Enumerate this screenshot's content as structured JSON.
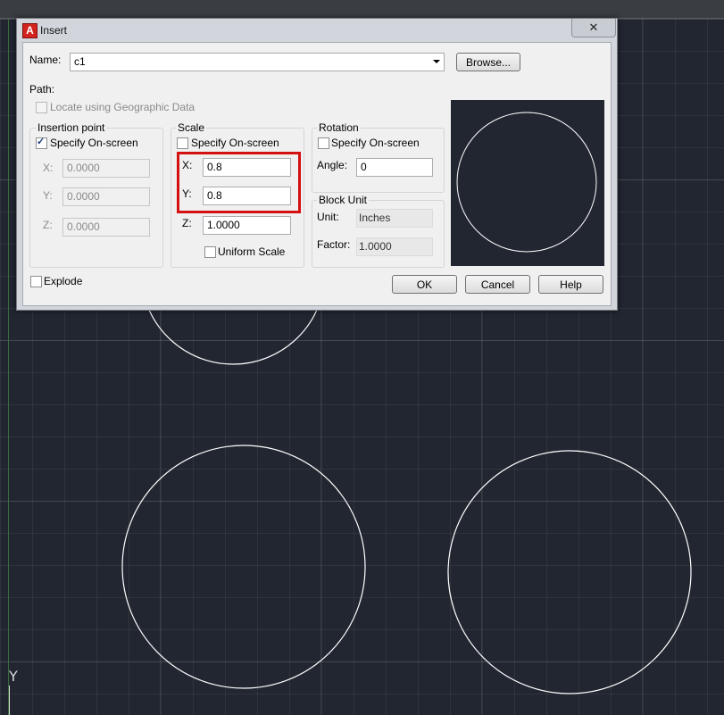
{
  "dialog": {
    "title": "Insert",
    "close_glyph": "✕",
    "name_label": "Name:",
    "name_value": "c1",
    "browse_label": "Browse...",
    "path_label": "Path:",
    "geo_label": "Locate using Geographic Data",
    "insertion_point": {
      "title": "Insertion point",
      "specify_label": "Specify On-screen",
      "specify_checked": true,
      "x_label": "X:",
      "x_value": "0.0000",
      "y_label": "Y:",
      "y_value": "0.0000",
      "z_label": "Z:",
      "z_value": "0.0000"
    },
    "scale": {
      "title": "Scale",
      "specify_label": "Specify On-screen",
      "specify_checked": false,
      "x_label": "X:",
      "x_value": "0.8",
      "y_label": "Y:",
      "y_value": "0.8",
      "z_label": "Z:",
      "z_value": "1.0000",
      "uniform_label": "Uniform Scale"
    },
    "rotation": {
      "title": "Rotation",
      "specify_label": "Specify On-screen",
      "angle_label": "Angle:",
      "angle_value": "0"
    },
    "block_unit": {
      "title": "Block Unit",
      "unit_label": "Unit:",
      "unit_value": "Inches",
      "factor_label": "Factor:",
      "factor_value": "1.0000"
    },
    "explode_label": "Explode",
    "ok_label": "OK",
    "cancel_label": "Cancel",
    "help_label": "Help"
  },
  "canvas": {
    "ucs_label": "Y"
  },
  "colors": {
    "canvas_bg": "#212630",
    "highlight": "#d41010",
    "circle_stroke": "#ffffff"
  },
  "icons": [
    "autocad-app-icon",
    "close-icon",
    "dropdown-arrow-icon",
    "checkbox-icon"
  ]
}
